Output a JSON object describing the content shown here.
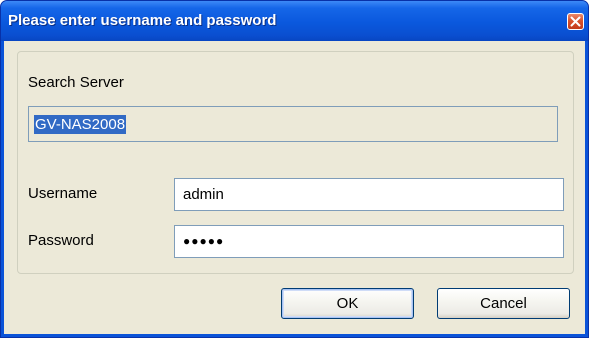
{
  "window": {
    "title": "Please enter username and password"
  },
  "search_server": {
    "label": "Search Server",
    "value": "GV-NAS2008"
  },
  "username": {
    "label": "Username",
    "value": "admin"
  },
  "password": {
    "label": "Password",
    "masked_value": "●●●●●"
  },
  "buttons": {
    "ok": "OK",
    "cancel": "Cancel"
  },
  "icons": {
    "close": "close-icon"
  },
  "colors": {
    "titlebar": "#0a58dd",
    "close_button": "#d8522d",
    "client_background": "#ece9d8",
    "selection_highlight": "#316ac5"
  }
}
